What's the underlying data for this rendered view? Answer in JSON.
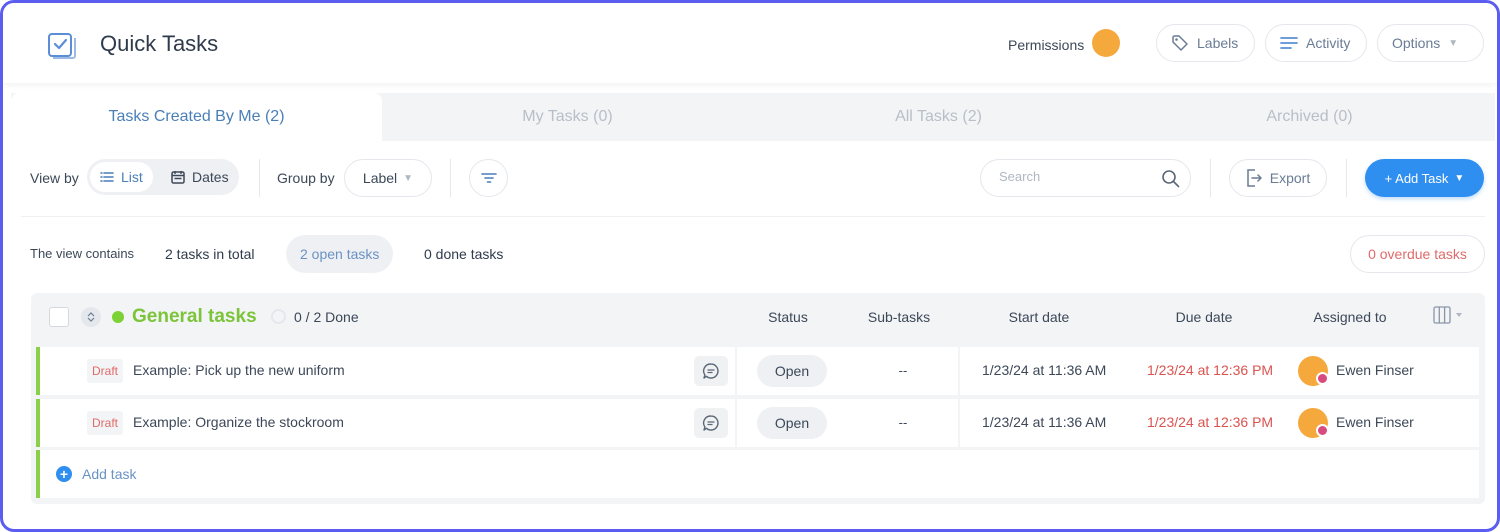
{
  "header": {
    "title": "Quick Tasks",
    "permissions_label": "Permissions",
    "labels_btn": "Labels",
    "activity_btn": "Activity",
    "options_btn": "Options"
  },
  "tabs": [
    {
      "label": "Tasks Created By Me (2)",
      "active": true
    },
    {
      "label": "My Tasks (0)",
      "active": false
    },
    {
      "label": "All Tasks (2)",
      "active": false
    },
    {
      "label": "Archived (0)",
      "active": false
    }
  ],
  "toolbar": {
    "view_by_label": "View by",
    "view_list": "List",
    "view_dates": "Dates",
    "group_by_label": "Group by",
    "group_by_value": "Label",
    "search_placeholder": "Search",
    "export_label": "Export",
    "add_task_label": "+ Add Task"
  },
  "summary": {
    "label": "The view contains",
    "total": "2 tasks in total",
    "open": "2 open tasks",
    "done": "0 done tasks",
    "overdue": "0 overdue tasks"
  },
  "group": {
    "title": "General tasks",
    "progress": "0 / 2 Done",
    "columns": {
      "status": "Status",
      "subtasks": "Sub-tasks",
      "start": "Start date",
      "due": "Due date",
      "assigned": "Assigned to"
    }
  },
  "tasks": [
    {
      "badge": "Draft",
      "name": "Example: Pick up the new uniform",
      "status": "Open",
      "subtasks": "--",
      "start": "1/23/24 at 11:36 AM",
      "due": "1/23/24 at 12:36 PM",
      "assignee": "Ewen Finser"
    },
    {
      "badge": "Draft",
      "name": "Example: Organize the stockroom",
      "status": "Open",
      "subtasks": "--",
      "start": "1/23/24 at 11:36 AM",
      "due": "1/23/24 at 12:36 PM",
      "assignee": "Ewen Finser"
    }
  ],
  "add_task_row_label": "Add task",
  "colors": {
    "accent_blue": "#2f8ff0",
    "group_green": "#7cc43a",
    "due_red": "#d9534f",
    "avatar_orange": "#f5a93d"
  }
}
